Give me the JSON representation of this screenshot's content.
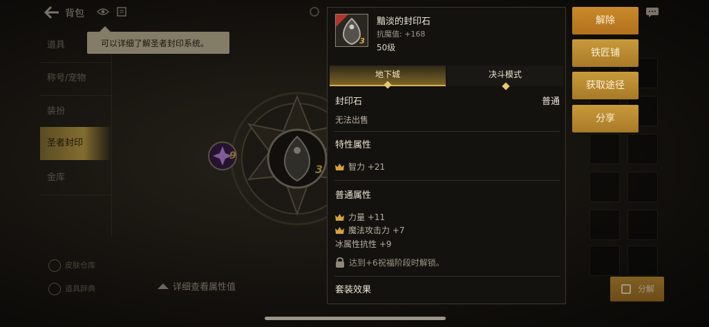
{
  "topbar": {
    "title": "背包"
  },
  "tooltip": {
    "text": "可以详细了解圣者封印系统。"
  },
  "sidebar": {
    "items": [
      {
        "label": "道具"
      },
      {
        "label": "称号/宠物"
      },
      {
        "label": "装扮"
      },
      {
        "label": "圣者封印"
      },
      {
        "label": "金库"
      }
    ],
    "footer": [
      {
        "label": "皮肤仓库"
      },
      {
        "label": "道具辞典"
      }
    ]
  },
  "seal": {
    "left_slot_count": "9",
    "center_slot_count": "3"
  },
  "detail_link": "详细查看属性值",
  "bottom_button": "分解",
  "item": {
    "name": "黯淡的封印石",
    "stat": "抗魔值: +168",
    "level": "50级",
    "badge_count": "3",
    "tabs": [
      "地下城",
      "决斗模式"
    ],
    "type_label": "封印石",
    "rarity": "普通",
    "trade": "无法出售",
    "special_title": "特性属性",
    "special_attrs": [
      "智力 +21"
    ],
    "normal_title": "普通属性",
    "normal_attrs": [
      "力量 +11",
      "魔法攻击力 +7",
      "冰属性抗性 +9"
    ],
    "lock_text": "达到+6祝福阶段时解锁。",
    "set_title": "套装效果"
  },
  "actions": {
    "unequip": "解除",
    "smith": "铁匠铺",
    "source": "获取途径",
    "share": "分享"
  },
  "colors": {
    "gold": "#c99a3a",
    "accent": "#d6b259"
  }
}
